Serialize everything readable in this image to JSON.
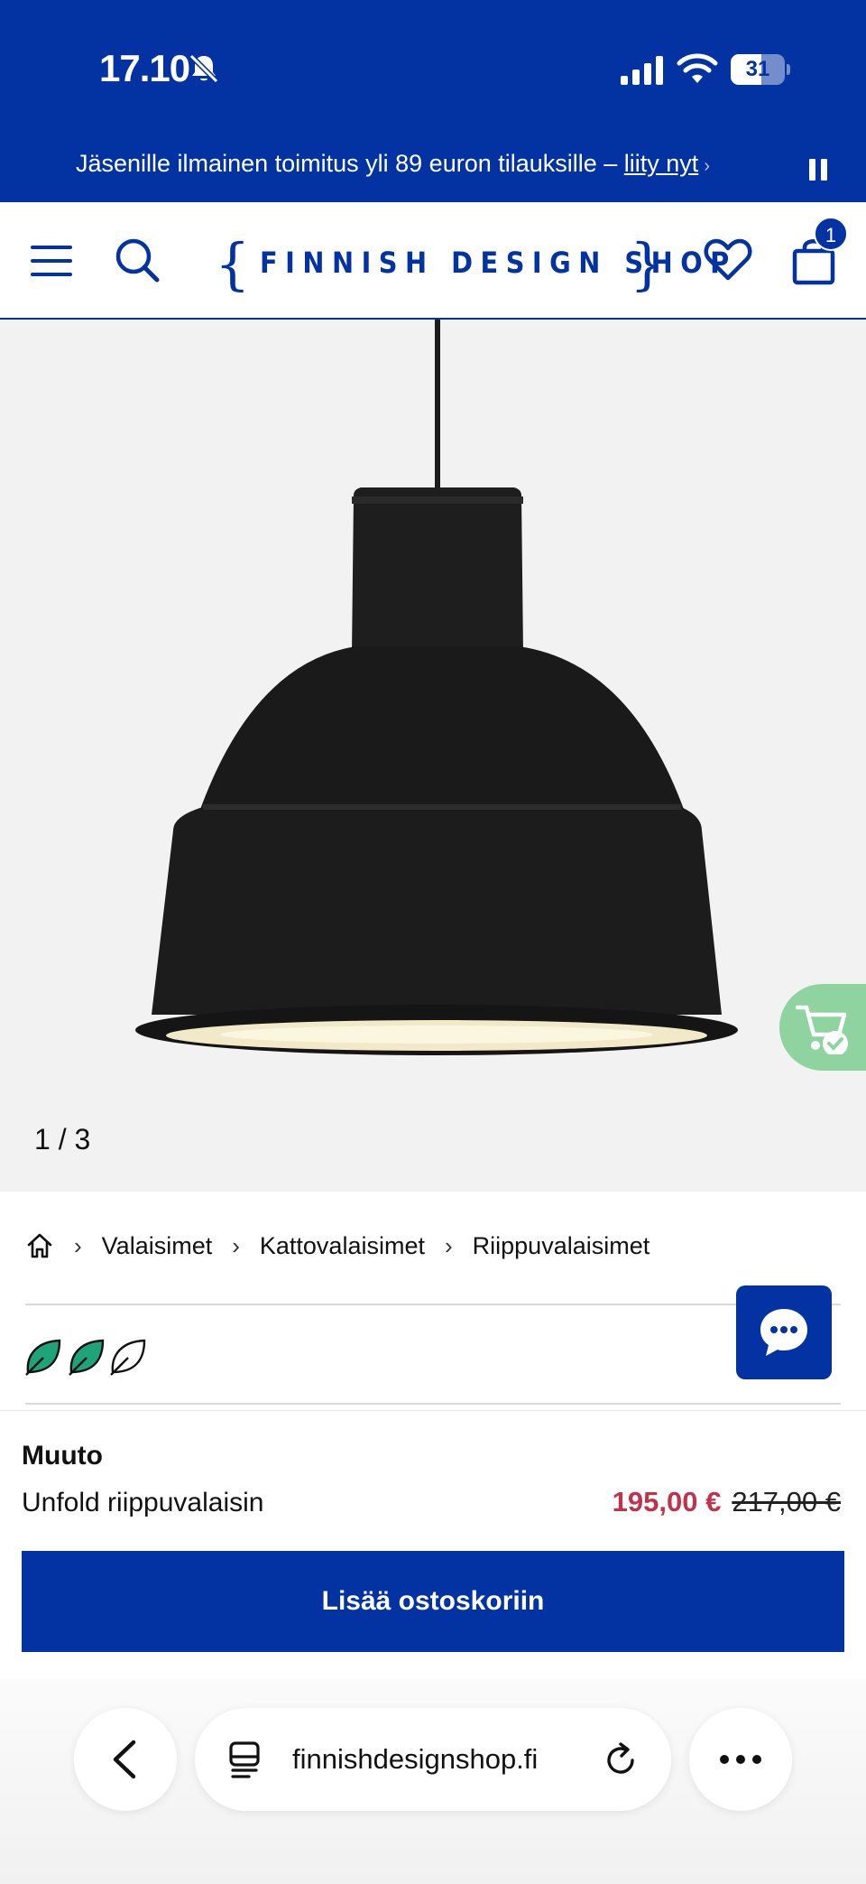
{
  "status_bar": {
    "time": "17.10",
    "battery": "31"
  },
  "promo": {
    "text": "Jäsenille ilmainen toimitus yli 89 euron tilauksille – ",
    "link": "liity nyt",
    "chevron": "›"
  },
  "header": {
    "logo": "FINNISH DESIGN SHOP",
    "cart_count": "1"
  },
  "gallery": {
    "counter": "1 / 3",
    "current": 1,
    "total": 3
  },
  "breadcrumb": {
    "items": [
      "Valaisimet",
      "Kattovalaisimet",
      "Riippuvalaisimet"
    ],
    "separator": "›"
  },
  "eco_rating": {
    "filled": 2,
    "total": 3,
    "color": "#1fa47a"
  },
  "product": {
    "brand": "Muuto",
    "name": "Unfold riippuvalaisin",
    "sale_price": "195,00 €",
    "original_price": "217,00 €",
    "add_to_cart": "Lisää ostoskoriin"
  },
  "browser": {
    "url": "finnishdesignshop.fi"
  },
  "colors": {
    "brand_blue": "#0332a3",
    "sale_red": "#c0334d",
    "eco_green": "#1fa47a"
  }
}
